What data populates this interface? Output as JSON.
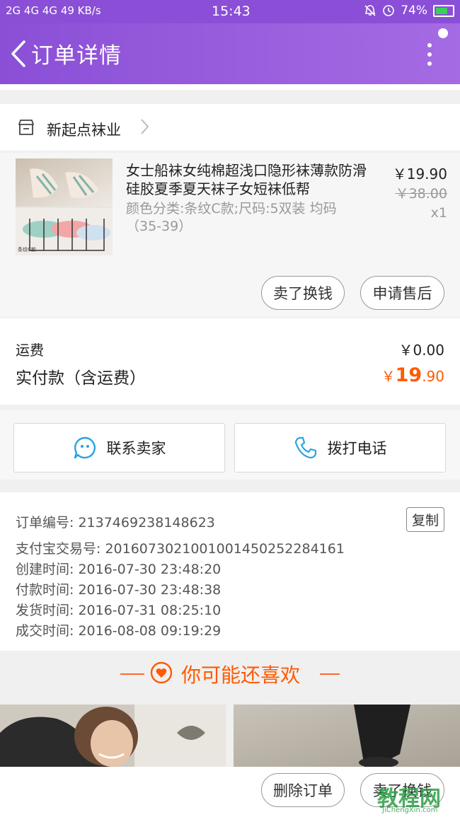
{
  "status_bar": {
    "signal": "2G 4G 4G",
    "speed": "49 KB/s",
    "time": "15:43",
    "battery": "74%"
  },
  "header": {
    "title": "订单详情"
  },
  "store": {
    "name": "新起点袜业"
  },
  "item": {
    "title": "女士船袜女纯棉超浅口隐形袜薄款防滑硅胶夏季夏天袜子女短袜低帮",
    "sku": "颜色分类:条纹C款;尺码:5双装 均码（35-39）",
    "thumb_label": "条纹C款",
    "price": "￥19.90",
    "original_price": "￥38.00",
    "quantity": "x1",
    "sell_button": "卖了换钱",
    "after_sale_button": "申请售后"
  },
  "totals": {
    "freight_label": "运费",
    "freight_value": "￥0.00",
    "paid_label": "实付款（含运费）",
    "paid_currency": "￥",
    "paid_int": "19",
    "paid_dec": ".90"
  },
  "contact": {
    "seller_button": "联系卖家",
    "call_button": "拨打电话"
  },
  "order_info": {
    "order_no_label": "订单编号:",
    "order_no": "2137469238148623",
    "copy_button": "复制",
    "alipay_label": "支付宝交易号:",
    "alipay_no": "2016073021001001450252284161",
    "created_label": "创建时间:",
    "created": "2016-07-30 23:48:20",
    "paid_label": "付款时间:",
    "paid": "2016-07-30 23:48:38",
    "shipped_label": "发货时间:",
    "shipped": "2016-07-31 08:25:10",
    "completed_label": "成交时间:",
    "completed": "2016-08-08 09:19:29"
  },
  "recommend": {
    "title": "你可能还喜欢"
  },
  "bottom_bar": {
    "delete_button": "删除订单",
    "sell_button": "卖了换钱"
  },
  "watermark": {
    "text": "教程网",
    "url": "JiChengXin.com"
  },
  "colors": {
    "header": "#8a4fd6",
    "accent": "#ff5a00"
  }
}
